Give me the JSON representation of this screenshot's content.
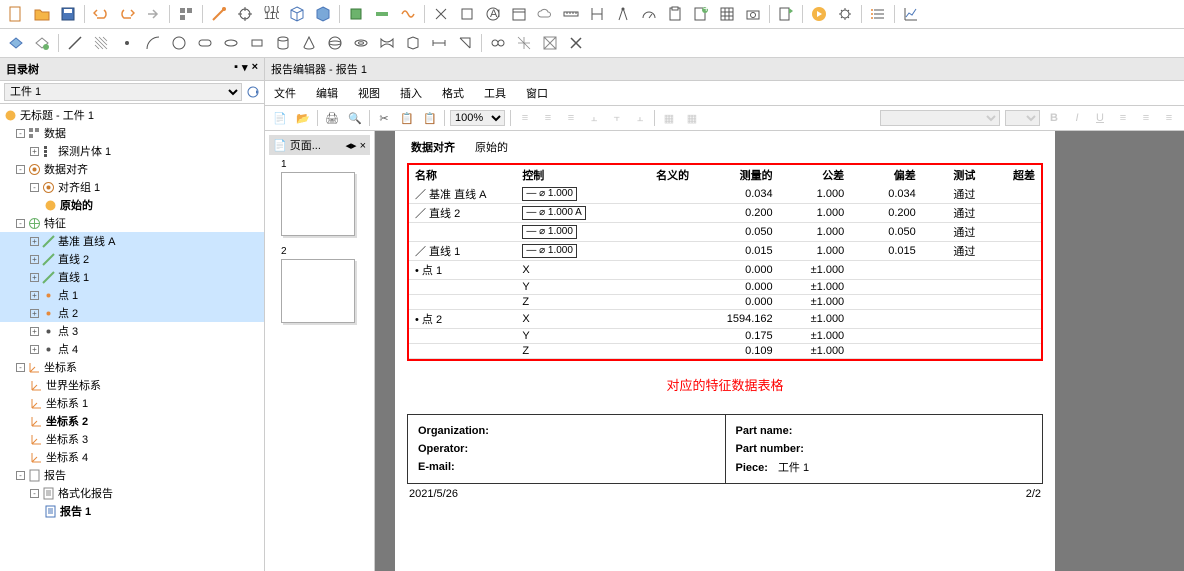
{
  "left_panel": {
    "title": "目录树",
    "selector": "工件 1",
    "root": "无标题 - 工件 1",
    "nodes": {
      "data": "数据",
      "probe": "探测片体 1",
      "align": "数据对齐",
      "align_group": "对齐组 1",
      "original": "原始的",
      "features": "特征",
      "datum_line_a": "基准 直线 A",
      "line2": "直线 2",
      "line1": "直线 1",
      "point1": "点 1",
      "point2": "点 2",
      "point3": "点 3",
      "point4": "点 4",
      "coord": "坐标系",
      "world": "世界坐标系",
      "cs1": "坐标系 1",
      "cs2": "坐标系 2",
      "cs3": "坐标系 3",
      "cs4": "坐标系 4",
      "report": "报告",
      "fmt_report": "格式化报告",
      "report1": "报告 1"
    }
  },
  "right_panel": {
    "title": "报告编辑器 - 报告 1",
    "menu": {
      "file": "文件",
      "edit": "编辑",
      "view": "视图",
      "insert": "插入",
      "format": "格式",
      "tool": "工具",
      "window": "窗口"
    },
    "zoom": "100%",
    "thumb_title": "页面..."
  },
  "doc": {
    "section": "数据对齐",
    "section_sub": "原始的",
    "headers": {
      "name": "名称",
      "control": "控制",
      "nominal": "名义的",
      "measured": "测量的",
      "tol": "公差",
      "dev": "偏差",
      "test": "测试",
      "out": "超差"
    },
    "rows": [
      {
        "name": "基准 直线 A",
        "prefix": "／",
        "control": "⌀ 1.000",
        "measured": "0.034",
        "tol": "1.000",
        "dev": "0.034",
        "test": "通过"
      },
      {
        "name": "直线 2",
        "prefix": "／",
        "control": "⌀ 1.000 A",
        "measured": "0.200",
        "tol": "1.000",
        "dev": "0.200",
        "test": "通过"
      },
      {
        "name": "",
        "prefix": "",
        "control": "⌀ 1.000",
        "measured": "0.050",
        "tol": "1.000",
        "dev": "0.050",
        "test": "通过"
      },
      {
        "name": "直线 1",
        "prefix": "／",
        "control": "⌀ 1.000",
        "measured": "0.015",
        "tol": "1.000",
        "dev": "0.015",
        "test": "通过"
      },
      {
        "name": "点 1",
        "prefix": "•",
        "control_plain": "X",
        "measured": "0.000",
        "tol": "±1.000"
      },
      {
        "name": "",
        "prefix": "",
        "control_plain": "Y",
        "measured": "0.000",
        "tol": "±1.000"
      },
      {
        "name": "",
        "prefix": "",
        "control_plain": "Z",
        "measured": "0.000",
        "tol": "±1.000"
      },
      {
        "name": "点 2",
        "prefix": "•",
        "control_plain": "X",
        "measured": "1594.162",
        "tol": "±1.000"
      },
      {
        "name": "",
        "prefix": "",
        "control_plain": "Y",
        "measured": "0.175",
        "tol": "±1.000"
      },
      {
        "name": "",
        "prefix": "",
        "control_plain": "Z",
        "measured": "0.109",
        "tol": "±1.000"
      }
    ],
    "annotation": "对应的特征数据表格",
    "footer": {
      "org_label": "Organization:",
      "op_label": "Operator:",
      "email_label": "E-mail:",
      "part_name_label": "Part name:",
      "part_num_label": "Part number:",
      "piece_label": "Piece:",
      "piece_val": "工件 1"
    },
    "date": "2021/5/26",
    "page_num": "2/2"
  }
}
